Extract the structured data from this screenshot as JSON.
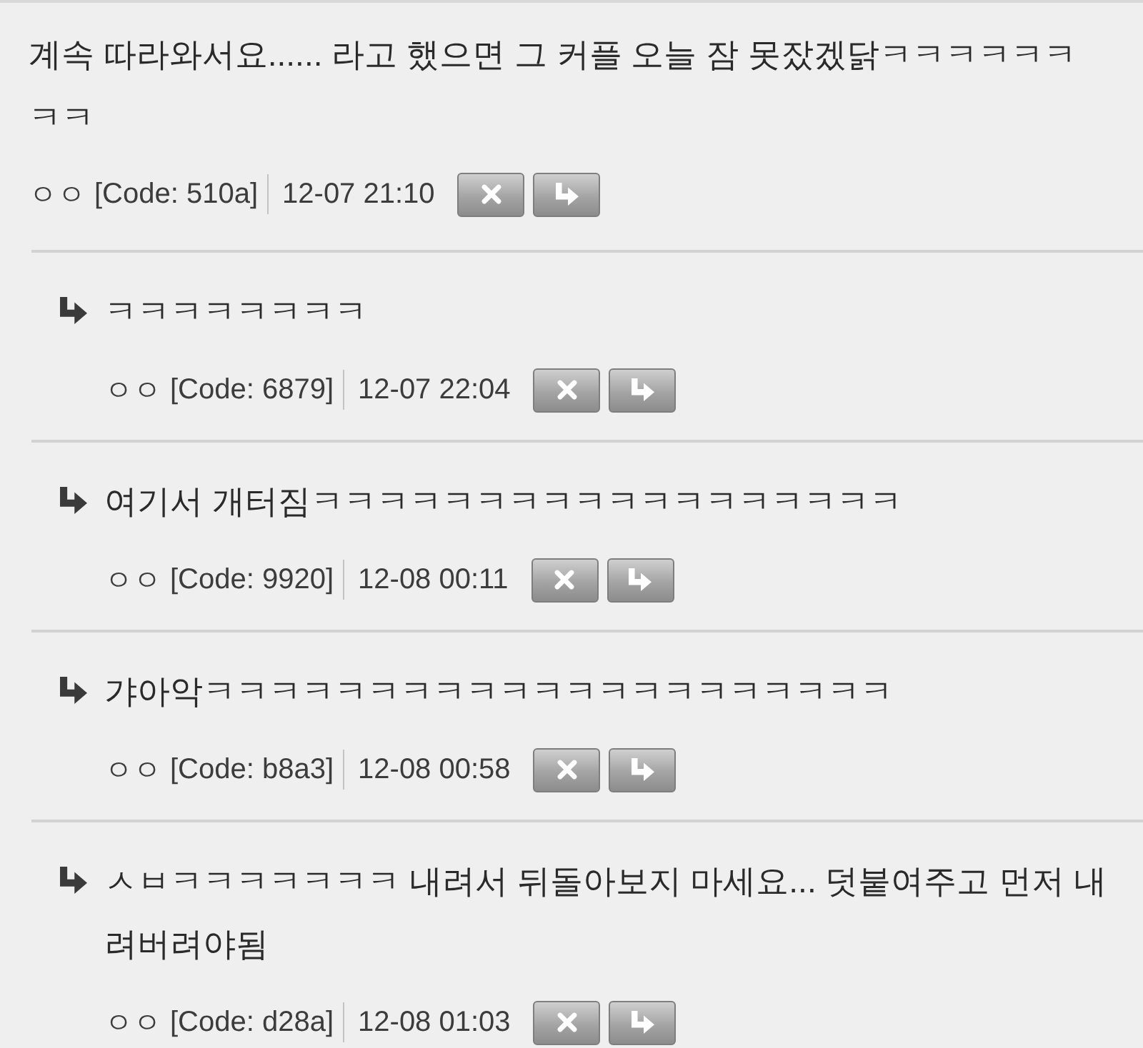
{
  "comment": {
    "text": "계속 따라와서요...... 라고 했으면 그 커플 오늘 잠 못잤겠닭ㅋㅋㅋㅋㅋㅋㅋㅋ",
    "author": "ㅇㅇ",
    "code": "[Code: 510a]",
    "time": "12-07 21:10"
  },
  "replies": [
    {
      "text": "ㅋㅋㅋㅋㅋㅋㅋㅋ",
      "author": "ㅇㅇ",
      "code": "[Code: 6879]",
      "time": "12-07 22:04"
    },
    {
      "text": "여기서 개터짐ㅋㅋㅋㅋㅋㅋㅋㅋㅋㅋㅋㅋㅋㅋㅋㅋㅋㅋ",
      "author": "ㅇㅇ",
      "code": "[Code: 9920]",
      "time": "12-08 00:11"
    },
    {
      "text": "갸아악ㅋㅋㅋㅋㅋㅋㅋㅋㅋㅋㅋㅋㅋㅋㅋㅋㅋㅋㅋㅋㅋ",
      "author": "ㅇㅇ",
      "code": "[Code: b8a3]",
      "time": "12-08 00:58"
    },
    {
      "text": "ㅅㅂㅋㅋㅋㅋㅋㅋㅋ 내려서 뒤돌아보지 마세요... 덧붙여주고 먼저 내려버려야됨",
      "author": "ㅇㅇ",
      "code": "[Code: d28a]",
      "time": "12-08 01:03"
    }
  ]
}
